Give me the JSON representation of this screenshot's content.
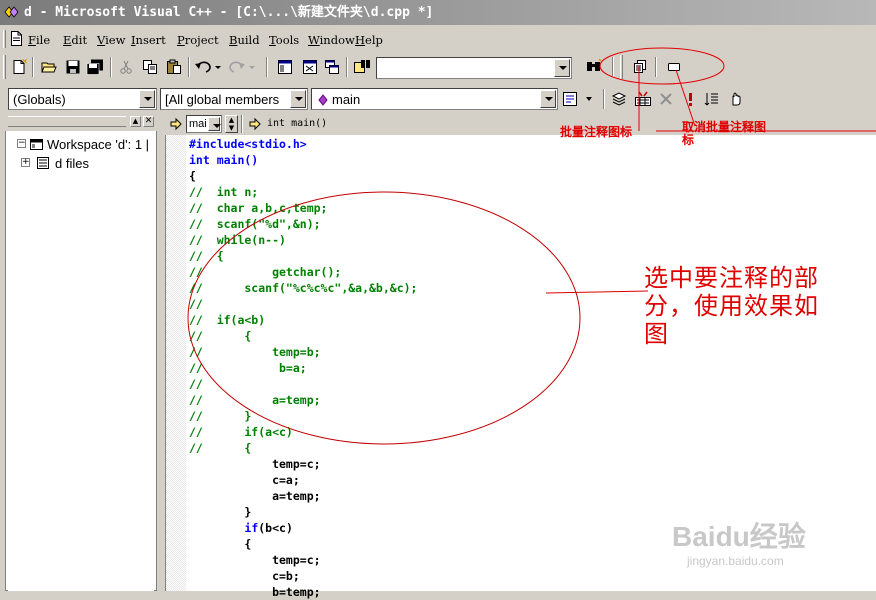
{
  "window": {
    "title": "d - Microsoft Visual C++ - [C:\\...\\新建文件夹\\d.cpp *]"
  },
  "menu": {
    "items": [
      "File",
      "Edit",
      "View",
      "Insert",
      "Project",
      "Build",
      "Tools",
      "Window",
      "Help"
    ],
    "underline": [
      "F",
      "E",
      "V",
      "I",
      "P",
      "B",
      "T",
      "W",
      "H"
    ]
  },
  "toolbar": {
    "find_combo_value": "",
    "icons": [
      "new-text-file-icon",
      "open-folder-icon",
      "save-icon",
      "save-all-icon",
      "cut-icon",
      "copy-icon",
      "paste-icon",
      "undo-icon",
      "redo-icon",
      "workspace-icon",
      "output-icon",
      "window-list-icon",
      "find-in-files-icon",
      "find-icon",
      "comment-block-icon",
      "uncomment-block-icon"
    ]
  },
  "wizardbar": {
    "scope": "(Globals)",
    "members": "[All global members",
    "function": "main",
    "icons": [
      "wizard-action-icon",
      "compile-icon",
      "build-icon",
      "stop-build-icon",
      "execute-icon",
      "insert-breakpoint-icon",
      "go-icon"
    ]
  },
  "workspace": {
    "root_label": "Workspace 'd': 1 |",
    "child_label": "d files"
  },
  "editor": {
    "nav_combo": "mai",
    "nav_function": "int main()",
    "lines": [
      [
        {
          "t": "#include<stdio.h>",
          "c": "kw"
        }
      ],
      [
        {
          "t": "int main()",
          "c": "kw"
        }
      ],
      [
        {
          "t": "{",
          "c": "nm"
        }
      ],
      [
        {
          "t": "//  int n;",
          "c": "cm"
        }
      ],
      [
        {
          "t": "//  char a,b,c,temp;",
          "c": "cm"
        }
      ],
      [
        {
          "t": "//  scanf(\"%d\",&n);",
          "c": "cm"
        }
      ],
      [
        {
          "t": "//  while(n--)",
          "c": "cm"
        }
      ],
      [
        {
          "t": "//  {",
          "c": "cm"
        }
      ],
      [
        {
          "t": "//          getchar();",
          "c": "cm"
        }
      ],
      [
        {
          "t": "//      scanf(\"%c%c%c\",&a,&b,&c);",
          "c": "cm"
        }
      ],
      [
        {
          "t": "//",
          "c": "cm"
        }
      ],
      [
        {
          "t": "//  if(a<b)",
          "c": "cm"
        }
      ],
      [
        {
          "t": "//      {",
          "c": "cm"
        }
      ],
      [
        {
          "t": "//          temp=b;",
          "c": "cm"
        }
      ],
      [
        {
          "t": "//           b=a;",
          "c": "cm"
        }
      ],
      [
        {
          "t": "//",
          "c": "cm"
        }
      ],
      [
        {
          "t": "//          a=temp;",
          "c": "cm"
        }
      ],
      [
        {
          "t": "//      }",
          "c": "cm"
        }
      ],
      [
        {
          "t": "//      if(a<c)",
          "c": "cm"
        }
      ],
      [
        {
          "t": "//      {",
          "c": "cm"
        }
      ],
      [
        {
          "t": "            temp=c;",
          "c": "nm"
        }
      ],
      [
        {
          "t": "            c=a;",
          "c": "nm"
        }
      ],
      [
        {
          "t": "            a=temp;",
          "c": "nm"
        }
      ],
      [
        {
          "t": "        }",
          "c": "nm"
        }
      ],
      [
        {
          "t": "        ",
          "c": "nm"
        },
        {
          "t": "if",
          "c": "kw"
        },
        {
          "t": "(b<c)",
          "c": "nm"
        }
      ],
      [
        {
          "t": "        {",
          "c": "nm"
        }
      ],
      [
        {
          "t": "            temp=c;",
          "c": "nm"
        }
      ],
      [
        {
          "t": "            c=b;",
          "c": "nm"
        }
      ],
      [
        {
          "t": "            b=temp;",
          "c": "nm"
        }
      ]
    ]
  },
  "annotations": {
    "comment_label": "批量注释图标",
    "uncomment_label_line1": "取消批量注释图",
    "uncomment_label_line2": "标",
    "selection_note": "选中要注释的部分，使用效果如图"
  },
  "watermark": {
    "brand": "Baidu经验",
    "url": "jingyan.baidu.com"
  },
  "colors": {
    "keyword": "#0000ff",
    "comment": "#008000",
    "annotation": "#e00000",
    "titlebar": "#808080"
  }
}
